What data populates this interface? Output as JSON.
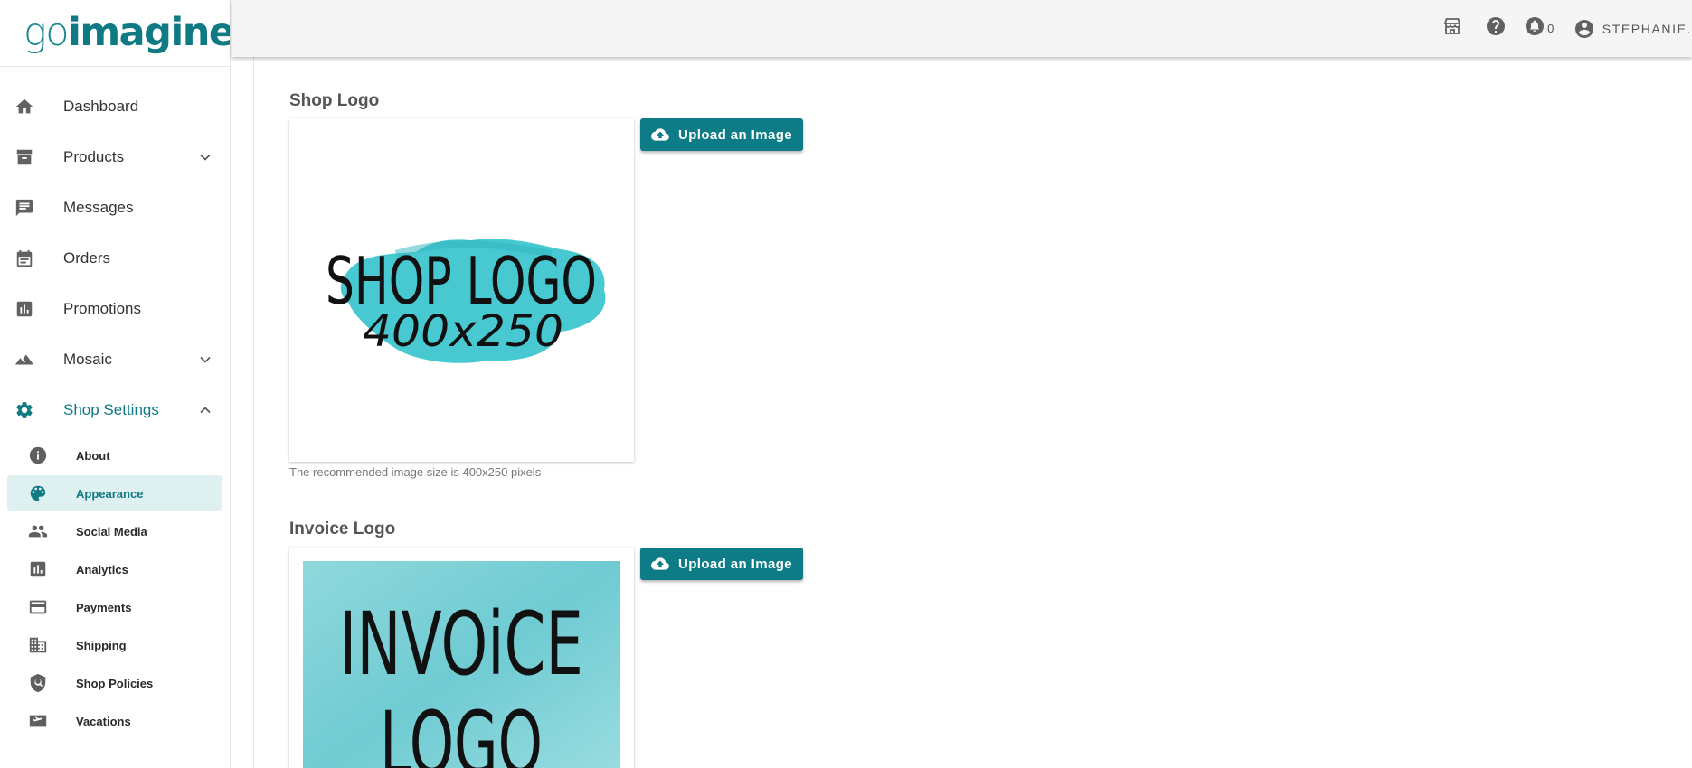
{
  "brand": {
    "go": "go",
    "imagine": "imagine"
  },
  "sidebar": {
    "items": [
      {
        "label": "Dashboard",
        "icon": "home-icon"
      },
      {
        "label": "Products",
        "icon": "archive-icon",
        "expandable": true
      },
      {
        "label": "Messages",
        "icon": "message-icon"
      },
      {
        "label": "Orders",
        "icon": "calendar-icon"
      },
      {
        "label": "Promotions",
        "icon": "chart-icon"
      },
      {
        "label": "Mosaic",
        "icon": "landscape-icon",
        "expandable": true
      },
      {
        "label": "Shop Settings",
        "icon": "gear-icon",
        "expanded": true
      }
    ],
    "sub_items": [
      {
        "label": "About",
        "icon": "info-icon"
      },
      {
        "label": "Appearance",
        "icon": "palette-icon",
        "selected": true
      },
      {
        "label": "Social Media",
        "icon": "people-icon"
      },
      {
        "label": "Analytics",
        "icon": "analytics-icon"
      },
      {
        "label": "Payments",
        "icon": "credit-card-icon"
      },
      {
        "label": "Shipping",
        "icon": "building-icon"
      },
      {
        "label": "Shop Policies",
        "icon": "shield-icon"
      },
      {
        "label": "Vacations",
        "icon": "flight-icon"
      }
    ]
  },
  "topbar": {
    "notifications_count": "0",
    "user_name": "STEPHANIE."
  },
  "main": {
    "shop_logo": {
      "title": "Shop Logo",
      "upload_label": "Upload an Image",
      "caption": "The recommended image size is 400x250 pixels",
      "image_line1": "SHOP LOGO",
      "image_line2": "400x250"
    },
    "invoice_logo": {
      "title": "Invoice Logo",
      "upload_label": "Upload an Image",
      "image_line1": "INVOiCE",
      "image_line2": "LOGO"
    }
  },
  "colors": {
    "accent": "#0e7c86",
    "selected_bg": "#dff0f1",
    "topbar_bg": "#f5f5f5",
    "logo_paint": "#3ec6cf"
  }
}
